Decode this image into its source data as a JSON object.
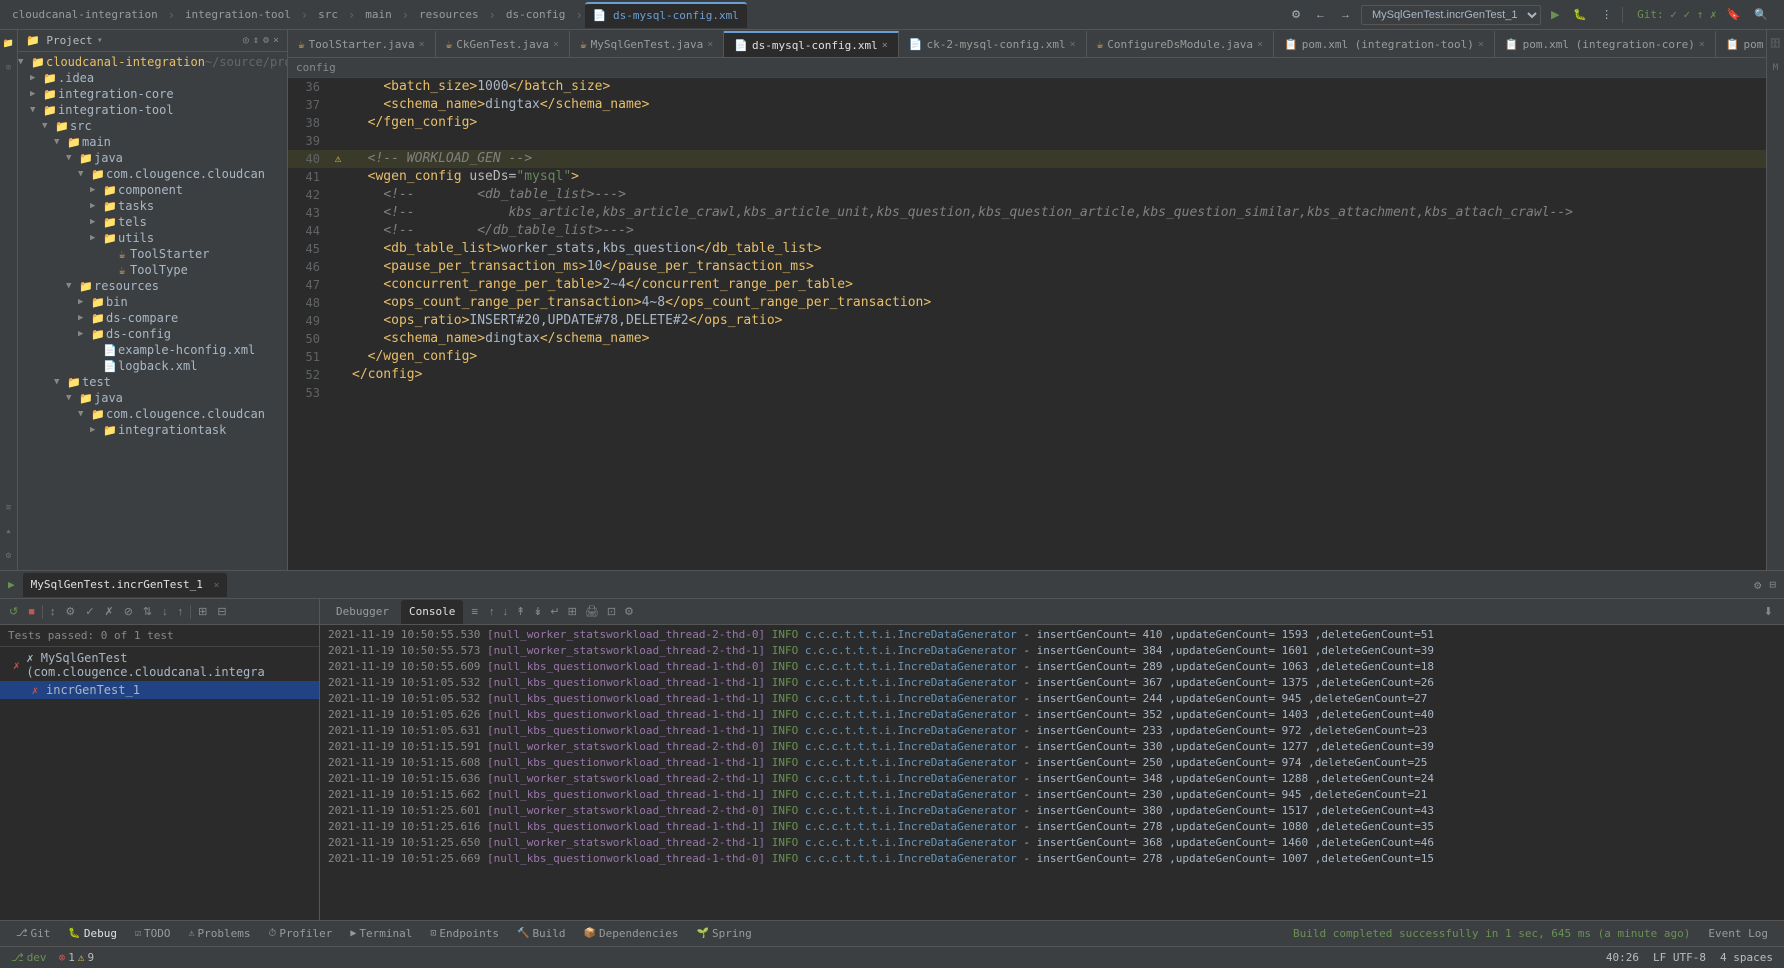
{
  "top_tabs": [
    {
      "label": "cloudcanal-integration",
      "active": false,
      "closable": false
    },
    {
      "label": "integration-tool",
      "active": false,
      "closable": false
    },
    {
      "label": "src",
      "active": false,
      "closable": false
    },
    {
      "label": "main",
      "active": false,
      "closable": false
    },
    {
      "label": "resources",
      "active": false,
      "closable": false
    },
    {
      "label": "ds-config",
      "active": false,
      "closable": false
    },
    {
      "label": "ds-mysql-config.xml",
      "active": true,
      "closable": false
    }
  ],
  "run_config": "MySqlGenTest.incrGenTest_1",
  "git_status": "Git: ✓ ✓ ↑ ✗",
  "editor_tabs": [
    {
      "label": "ToolStarter.java",
      "icon": "☕",
      "active": false,
      "modified": false
    },
    {
      "label": "CkGenTest.java",
      "icon": "☕",
      "active": false,
      "modified": false
    },
    {
      "label": "MySqlGenTest.java",
      "icon": "☕",
      "active": false,
      "modified": false
    },
    {
      "label": "ds-mysql-config.xml",
      "icon": "📄",
      "active": true,
      "modified": false
    },
    {
      "label": "ck-2-mysql-config.xml",
      "icon": "📄",
      "active": false,
      "modified": false
    },
    {
      "label": "ConfigureDsModule.java",
      "icon": "☕",
      "active": false,
      "modified": false
    },
    {
      "label": "pom.xml (integration-tool)",
      "icon": "📋",
      "active": false,
      "modified": false
    },
    {
      "label": "pom.xml (integration-core)",
      "icon": "📋",
      "active": false,
      "modified": false
    },
    {
      "label": "pom.xml (cloudcanal-integration)",
      "icon": "📋",
      "active": false,
      "modified": false
    }
  ],
  "code_lines": [
    {
      "num": 36,
      "gutter": "",
      "content": "    <batch_size>1000</batch_size>",
      "highlight": false
    },
    {
      "num": 37,
      "gutter": "",
      "content": "    <schema_name>dingtax</schema_name>",
      "highlight": false
    },
    {
      "num": 38,
      "gutter": "",
      "content": "  </fgen_config>",
      "highlight": false
    },
    {
      "num": 39,
      "gutter": "",
      "content": "",
      "highlight": false
    },
    {
      "num": 40,
      "gutter": "⚠",
      "content": "  <!-- WORKLOAD_GEN -->",
      "highlight": true
    },
    {
      "num": 41,
      "gutter": "",
      "content": "  <wgen_config useDs=\"mysql\">",
      "highlight": false
    },
    {
      "num": 42,
      "gutter": "",
      "content": "    <!--        <db_table_list>--->",
      "highlight": false
    },
    {
      "num": 43,
      "gutter": "",
      "content": "    <!--            kbs_article,kbs_article_crawl,kbs_article_unit,kbs_question,kbs_question_article,kbs_question_similar,kbs_attachment,kbs_attach_crawl-->",
      "highlight": false
    },
    {
      "num": 44,
      "gutter": "",
      "content": "    <!--        </db_table_list>--->",
      "highlight": false
    },
    {
      "num": 45,
      "gutter": "",
      "content": "    <db_table_list>worker_stats,kbs_question</db_table_list>",
      "highlight": false
    },
    {
      "num": 46,
      "gutter": "",
      "content": "    <pause_per_transaction_ms>10</pause_per_transaction_ms>",
      "highlight": false
    },
    {
      "num": 47,
      "gutter": "",
      "content": "    <concurrent_range_per_table>2~4</concurrent_range_per_table>",
      "highlight": false
    },
    {
      "num": 48,
      "gutter": "",
      "content": "    <ops_count_range_per_transaction>4~8</ops_count_range_per_transaction>",
      "highlight": false
    },
    {
      "num": 49,
      "gutter": "",
      "content": "    <ops_ratio>INSERT#20,UPDATE#78,DELETE#2</ops_ratio>",
      "highlight": false
    },
    {
      "num": 50,
      "gutter": "",
      "content": "    <schema_name>dingtax</schema_name>",
      "highlight": false
    },
    {
      "num": 51,
      "gutter": "",
      "content": "  </wgen_config>",
      "highlight": false
    },
    {
      "num": 52,
      "gutter": "",
      "content": "</config>",
      "highlight": false
    },
    {
      "num": 53,
      "gutter": "",
      "content": "",
      "highlight": false
    }
  ],
  "breadcrumb": "config",
  "project_tree": {
    "title": "Project",
    "items": [
      {
        "indent": 0,
        "arrow": "▼",
        "icon": "📁",
        "label": "cloudcanal-integration ~/source/prod",
        "type": "folder",
        "expanded": true
      },
      {
        "indent": 1,
        "arrow": "▶",
        "icon": "📁",
        "label": ".idea",
        "type": "folder",
        "expanded": false
      },
      {
        "indent": 1,
        "arrow": "▼",
        "icon": "📁",
        "label": "integration-core",
        "type": "folder",
        "expanded": false
      },
      {
        "indent": 1,
        "arrow": "▼",
        "icon": "📁",
        "label": "integration-tool",
        "type": "folder",
        "expanded": true
      },
      {
        "indent": 2,
        "arrow": "▼",
        "icon": "📁",
        "label": "src",
        "type": "folder",
        "expanded": true
      },
      {
        "indent": 3,
        "arrow": "▼",
        "icon": "📁",
        "label": "main",
        "type": "folder",
        "expanded": true
      },
      {
        "indent": 4,
        "arrow": "▼",
        "icon": "📁",
        "label": "java",
        "type": "folder",
        "expanded": true
      },
      {
        "indent": 5,
        "arrow": "▼",
        "icon": "📁",
        "label": "com.clougence.cloudcan",
        "type": "folder",
        "expanded": true
      },
      {
        "indent": 6,
        "arrow": "▼",
        "icon": "📁",
        "label": "component",
        "type": "folder",
        "expanded": false
      },
      {
        "indent": 6,
        "arrow": "▼",
        "icon": "📁",
        "label": "tasks",
        "type": "folder",
        "expanded": false
      },
      {
        "indent": 6,
        "arrow": "▼",
        "icon": "📁",
        "label": "tels",
        "type": "folder",
        "expanded": false
      },
      {
        "indent": 6,
        "arrow": "▼",
        "icon": "📁",
        "label": "utils",
        "type": "folder",
        "expanded": false
      },
      {
        "indent": 6,
        "arrow": "",
        "icon": "☕",
        "label": "ToolStarter",
        "type": "java"
      },
      {
        "indent": 6,
        "arrow": "",
        "icon": "☕",
        "label": "ToolType",
        "type": "java"
      },
      {
        "indent": 4,
        "arrow": "▼",
        "icon": "📁",
        "label": "resources",
        "type": "folder",
        "expanded": true
      },
      {
        "indent": 5,
        "arrow": "▶",
        "icon": "📁",
        "label": "bin",
        "type": "folder",
        "expanded": false
      },
      {
        "indent": 5,
        "arrow": "▶",
        "icon": "📁",
        "label": "ds-compare",
        "type": "folder",
        "expanded": false
      },
      {
        "indent": 5,
        "arrow": "▶",
        "icon": "📁",
        "label": "ds-config",
        "type": "folder",
        "expanded": false
      },
      {
        "indent": 5,
        "arrow": "",
        "icon": "📄",
        "label": "example-hconfig.xml",
        "type": "xml"
      },
      {
        "indent": 5,
        "arrow": "",
        "icon": "📄",
        "label": "logback.xml",
        "type": "xml"
      },
      {
        "indent": 3,
        "arrow": "▼",
        "icon": "📁",
        "label": "test",
        "type": "folder",
        "expanded": true
      },
      {
        "indent": 4,
        "arrow": "▼",
        "icon": "📁",
        "label": "java",
        "type": "folder",
        "expanded": true
      },
      {
        "indent": 5,
        "arrow": "▼",
        "icon": "📁",
        "label": "com.clougence.cloudcan",
        "type": "folder",
        "expanded": true
      },
      {
        "indent": 6,
        "arrow": "▼",
        "icon": "📁",
        "label": "integrationtask",
        "type": "folder",
        "expanded": false
      }
    ]
  },
  "debug_panel": {
    "tab_label": "MySqlGenTest.incrGenTest_1",
    "tabs": [
      "Debugger",
      "Console"
    ],
    "active_tab": "Console",
    "tests_passed": "Tests passed: 0 of 1 test",
    "test_tree": [
      {
        "label": "MySqlGenTest (com.clougence.cloudcanal.integra",
        "type": "suite",
        "pass": false,
        "indent": 0
      },
      {
        "label": "incrGenTest_1",
        "type": "test",
        "pass": false,
        "indent": 1
      }
    ],
    "console_lines": [
      {
        "time": "2021-11-19 10:50:55.530",
        "thread": "[null_worker_statsworkload_thread-2-thd-0]",
        "level": "INFO",
        "class": "c.c.c.t.t.t.i.IncreDataGenerator",
        "msg": "- insertGenCount= 410 ,updateGenCount= 1593 ,deleteGenCount=51"
      },
      {
        "time": "2021-11-19 10:50:55.573",
        "thread": "[null_worker_statsworkload_thread-2-thd-1]",
        "level": "INFO",
        "class": "c.c.c.t.t.t.i.IncreDataGenerator",
        "msg": "- insertGenCount= 384 ,updateGenCount= 1601 ,deleteGenCount=39"
      },
      {
        "time": "2021-11-19 10:50:55.609",
        "thread": "[null_kbs_questionworkload_thread-1-thd-0]",
        "level": "INFO",
        "class": "c.c.c.t.t.t.i.IncreDataGenerator",
        "msg": "- insertGenCount= 289 ,updateGenCount= 1063 ,deleteGenCount=18"
      },
      {
        "time": "2021-11-19 10:51:05.532",
        "thread": "[null_kbs_questionworkload_thread-1-thd-1]",
        "level": "INFO",
        "class": "c.c.c.t.t.t.i.IncreDataGenerator",
        "msg": "- insertGenCount= 367 ,updateGenCount= 1375 ,deleteGenCount=26"
      },
      {
        "time": "2021-11-19 10:51:05.532",
        "thread": "[null_kbs_questionworkload_thread-1-thd-1]",
        "level": "INFO",
        "class": "c.c.c.t.t.t.i.IncreDataGenerator",
        "msg": "- insertGenCount= 244 ,updateGenCount= 945  ,deleteGenCount=27"
      },
      {
        "time": "2021-11-19 10:51:05.626",
        "thread": "[null_kbs_questionworkload_thread-1-thd-1]",
        "level": "INFO",
        "class": "c.c.c.t.t.t.i.IncreDataGenerator",
        "msg": "- insertGenCount= 352 ,updateGenCount= 1403 ,deleteGenCount=40"
      },
      {
        "time": "2021-11-19 10:51:05.631",
        "thread": "[null_kbs_questionworkload_thread-1-thd-1]",
        "level": "INFO",
        "class": "c.c.c.t.t.t.i.IncreDataGenerator",
        "msg": "- insertGenCount= 233 ,updateGenCount= 972  ,deleteGenCount=23"
      },
      {
        "time": "2021-11-19 10:51:15.591",
        "thread": "[null_worker_statsworkload_thread-2-thd-0]",
        "level": "INFO",
        "class": "c.c.c.t.t.t.i.IncreDataGenerator",
        "msg": "- insertGenCount= 330 ,updateGenCount= 1277 ,deleteGenCount=39"
      },
      {
        "time": "2021-11-19 10:51:15.608",
        "thread": "[null_kbs_questionworkload_thread-1-thd-1]",
        "level": "INFO",
        "class": "c.c.c.t.t.t.i.IncreDataGenerator",
        "msg": "- insertGenCount= 250 ,updateGenCount= 974  ,deleteGenCount=25"
      },
      {
        "time": "2021-11-19 10:51:15.636",
        "thread": "[null_worker_statsworkload_thread-2-thd-1]",
        "level": "INFO",
        "class": "c.c.c.t.t.t.i.IncreDataGenerator",
        "msg": "- insertGenCount= 348 ,updateGenCount= 1288 ,deleteGenCount=24"
      },
      {
        "time": "2021-11-19 10:51:15.662",
        "thread": "[null_kbs_questionworkload_thread-1-thd-1]",
        "level": "INFO",
        "class": "c.c.c.t.t.t.i.IncreDataGenerator",
        "msg": "- insertGenCount= 230 ,updateGenCount= 945  ,deleteGenCount=21"
      },
      {
        "time": "2021-11-19 10:51:25.601",
        "thread": "[null_worker_statsworkload_thread-2-thd-0]",
        "level": "INFO",
        "class": "c.c.c.t.t.t.i.IncreDataGenerator",
        "msg": "- insertGenCount= 380 ,updateGenCount= 1517 ,deleteGenCount=43"
      },
      {
        "time": "2021-11-19 10:51:25.616",
        "thread": "[null_kbs_questionworkload_thread-1-thd-1]",
        "level": "INFO",
        "class": "c.c.c.t.t.t.i.IncreDataGenerator",
        "msg": "- insertGenCount= 278 ,updateGenCount= 1080 ,deleteGenCount=35"
      },
      {
        "time": "2021-11-19 10:51:25.650",
        "thread": "[null_worker_statsworkload_thread-2-thd-1]",
        "level": "INFO",
        "class": "c.c.c.t.t.t.i.IncreDataGenerator",
        "msg": "- insertGenCount= 368 ,updateGenCount= 1460 ,deleteGenCount=46"
      },
      {
        "time": "2021-11-19 10:51:25.669",
        "thread": "[null_kbs_questionworkload_thread-1-thd-0]",
        "level": "INFO",
        "class": "c.c.c.t.t.t.i.IncreDataGenerator",
        "msg": "- insertGenCount= 278 ,updateGenCount= 1007 ,deleteGenCount=15"
      }
    ]
  },
  "bottom_nav": {
    "items": [
      {
        "icon": "⎇",
        "label": "Git",
        "active": false
      },
      {
        "icon": "🐛",
        "label": "Debug",
        "active": true
      },
      {
        "icon": "☑",
        "label": "TODO",
        "active": false
      },
      {
        "icon": "⚠",
        "label": "Problems",
        "active": false
      },
      {
        "icon": "⏱",
        "label": "Profiler",
        "active": false
      },
      {
        "icon": "▶",
        "label": "Terminal",
        "active": false
      },
      {
        "icon": "⊡",
        "label": "Endpoints",
        "active": false
      },
      {
        "icon": "🔨",
        "label": "Build",
        "active": false
      },
      {
        "icon": "📦",
        "label": "Dependencies",
        "active": false
      },
      {
        "icon": "🌱",
        "label": "Spring",
        "active": false
      },
      {
        "icon": "📋",
        "label": "Event Log",
        "active": false
      }
    ]
  },
  "status_bar": {
    "build_msg": "Build completed successfully in 1 sec, 645 ms (a minute ago)",
    "position": "40:26",
    "encoding": "LF  UTF-8",
    "indent": "4 spaces",
    "branch": "dev"
  }
}
